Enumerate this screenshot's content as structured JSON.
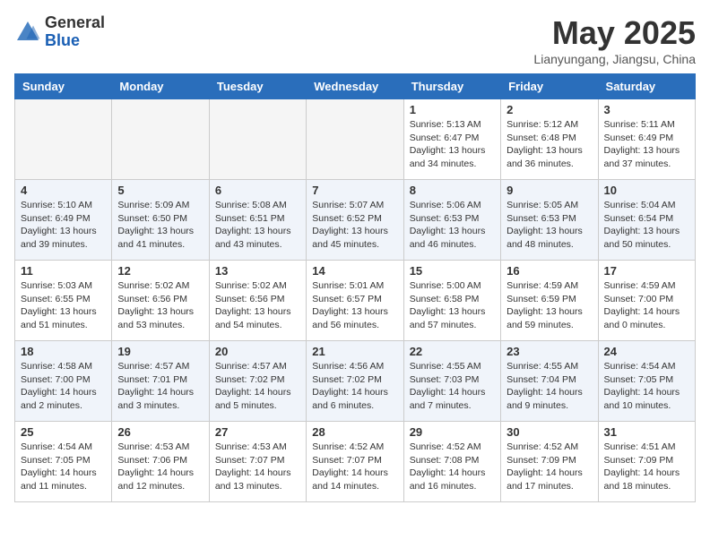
{
  "logo": {
    "general": "General",
    "blue": "Blue"
  },
  "title": "May 2025",
  "location": "Lianyungang, Jiangsu, China",
  "weekdays": [
    "Sunday",
    "Monday",
    "Tuesday",
    "Wednesday",
    "Thursday",
    "Friday",
    "Saturday"
  ],
  "weeks": [
    [
      {
        "day": "",
        "info": ""
      },
      {
        "day": "",
        "info": ""
      },
      {
        "day": "",
        "info": ""
      },
      {
        "day": "",
        "info": ""
      },
      {
        "day": "1",
        "info": "Sunrise: 5:13 AM\nSunset: 6:47 PM\nDaylight: 13 hours\nand 34 minutes."
      },
      {
        "day": "2",
        "info": "Sunrise: 5:12 AM\nSunset: 6:48 PM\nDaylight: 13 hours\nand 36 minutes."
      },
      {
        "day": "3",
        "info": "Sunrise: 5:11 AM\nSunset: 6:49 PM\nDaylight: 13 hours\nand 37 minutes."
      }
    ],
    [
      {
        "day": "4",
        "info": "Sunrise: 5:10 AM\nSunset: 6:49 PM\nDaylight: 13 hours\nand 39 minutes."
      },
      {
        "day": "5",
        "info": "Sunrise: 5:09 AM\nSunset: 6:50 PM\nDaylight: 13 hours\nand 41 minutes."
      },
      {
        "day": "6",
        "info": "Sunrise: 5:08 AM\nSunset: 6:51 PM\nDaylight: 13 hours\nand 43 minutes."
      },
      {
        "day": "7",
        "info": "Sunrise: 5:07 AM\nSunset: 6:52 PM\nDaylight: 13 hours\nand 45 minutes."
      },
      {
        "day": "8",
        "info": "Sunrise: 5:06 AM\nSunset: 6:53 PM\nDaylight: 13 hours\nand 46 minutes."
      },
      {
        "day": "9",
        "info": "Sunrise: 5:05 AM\nSunset: 6:53 PM\nDaylight: 13 hours\nand 48 minutes."
      },
      {
        "day": "10",
        "info": "Sunrise: 5:04 AM\nSunset: 6:54 PM\nDaylight: 13 hours\nand 50 minutes."
      }
    ],
    [
      {
        "day": "11",
        "info": "Sunrise: 5:03 AM\nSunset: 6:55 PM\nDaylight: 13 hours\nand 51 minutes."
      },
      {
        "day": "12",
        "info": "Sunrise: 5:02 AM\nSunset: 6:56 PM\nDaylight: 13 hours\nand 53 minutes."
      },
      {
        "day": "13",
        "info": "Sunrise: 5:02 AM\nSunset: 6:56 PM\nDaylight: 13 hours\nand 54 minutes."
      },
      {
        "day": "14",
        "info": "Sunrise: 5:01 AM\nSunset: 6:57 PM\nDaylight: 13 hours\nand 56 minutes."
      },
      {
        "day": "15",
        "info": "Sunrise: 5:00 AM\nSunset: 6:58 PM\nDaylight: 13 hours\nand 57 minutes."
      },
      {
        "day": "16",
        "info": "Sunrise: 4:59 AM\nSunset: 6:59 PM\nDaylight: 13 hours\nand 59 minutes."
      },
      {
        "day": "17",
        "info": "Sunrise: 4:59 AM\nSunset: 7:00 PM\nDaylight: 14 hours\nand 0 minutes."
      }
    ],
    [
      {
        "day": "18",
        "info": "Sunrise: 4:58 AM\nSunset: 7:00 PM\nDaylight: 14 hours\nand 2 minutes."
      },
      {
        "day": "19",
        "info": "Sunrise: 4:57 AM\nSunset: 7:01 PM\nDaylight: 14 hours\nand 3 minutes."
      },
      {
        "day": "20",
        "info": "Sunrise: 4:57 AM\nSunset: 7:02 PM\nDaylight: 14 hours\nand 5 minutes."
      },
      {
        "day": "21",
        "info": "Sunrise: 4:56 AM\nSunset: 7:02 PM\nDaylight: 14 hours\nand 6 minutes."
      },
      {
        "day": "22",
        "info": "Sunrise: 4:55 AM\nSunset: 7:03 PM\nDaylight: 14 hours\nand 7 minutes."
      },
      {
        "day": "23",
        "info": "Sunrise: 4:55 AM\nSunset: 7:04 PM\nDaylight: 14 hours\nand 9 minutes."
      },
      {
        "day": "24",
        "info": "Sunrise: 4:54 AM\nSunset: 7:05 PM\nDaylight: 14 hours\nand 10 minutes."
      }
    ],
    [
      {
        "day": "25",
        "info": "Sunrise: 4:54 AM\nSunset: 7:05 PM\nDaylight: 14 hours\nand 11 minutes."
      },
      {
        "day": "26",
        "info": "Sunrise: 4:53 AM\nSunset: 7:06 PM\nDaylight: 14 hours\nand 12 minutes."
      },
      {
        "day": "27",
        "info": "Sunrise: 4:53 AM\nSunset: 7:07 PM\nDaylight: 14 hours\nand 13 minutes."
      },
      {
        "day": "28",
        "info": "Sunrise: 4:52 AM\nSunset: 7:07 PM\nDaylight: 14 hours\nand 14 minutes."
      },
      {
        "day": "29",
        "info": "Sunrise: 4:52 AM\nSunset: 7:08 PM\nDaylight: 14 hours\nand 16 minutes."
      },
      {
        "day": "30",
        "info": "Sunrise: 4:52 AM\nSunset: 7:09 PM\nDaylight: 14 hours\nand 17 minutes."
      },
      {
        "day": "31",
        "info": "Sunrise: 4:51 AM\nSunset: 7:09 PM\nDaylight: 14 hours\nand 18 minutes."
      }
    ]
  ]
}
